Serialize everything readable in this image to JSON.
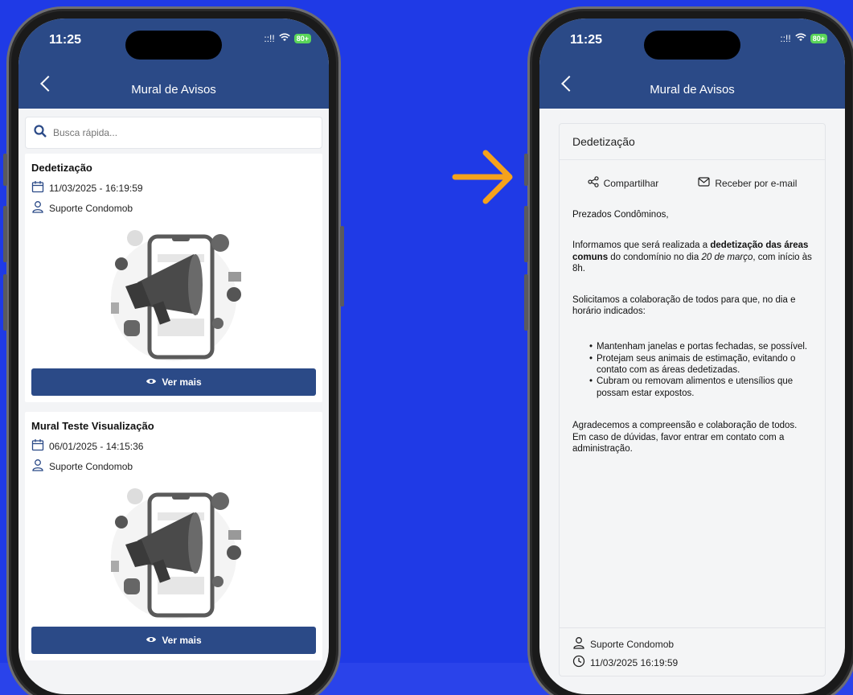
{
  "status": {
    "time": "11:25",
    "signal": "::!!",
    "battery": "80+"
  },
  "left_screen": {
    "header_title": "Mural de Avisos",
    "search_placeholder": "Busca rápida...",
    "cards": [
      {
        "title": "Dedetização",
        "date": "11/03/2025 - 16:19:59",
        "author": "Suporte Condomob",
        "button": "Ver mais"
      },
      {
        "title": "Mural Teste Visualização",
        "date": "06/01/2025 - 14:15:36",
        "author": "Suporte Condomob",
        "button": "Ver mais"
      }
    ]
  },
  "right_screen": {
    "header_title": "Mural de Avisos",
    "detail_title": "Dedetização",
    "share_label": "Compartilhar",
    "email_label": "Receber por e-mail",
    "greeting": "Prezados Condôminos,",
    "para1_pre": "Informamos que será realizada a ",
    "para1_bold": "dedetização das áreas comuns",
    "para1_mid": " do condomínio no dia ",
    "para1_italic": "20 de março",
    "para1_post": ", com início às 8h.",
    "para2": "Solicitamos a colaboração de todos para que, no dia e horário indicados:",
    "bullets": [
      "Mantenham janelas e portas fechadas, se possível.",
      "Protejam seus animais de estimação, evitando o contato com as áreas dedetizadas.",
      "Cubram ou removam alimentos e utensílios que possam estar expostos."
    ],
    "para3": "Agradecemos a compreensão e colaboração de todos. Em caso de dúvidas, favor entrar em contato com a administração.",
    "footer_author": "Suporte Condomob",
    "footer_date": "11/03/2025 16:19:59"
  },
  "colors": {
    "background": "#1f3ae6",
    "header": "#2b4a87",
    "arrow": "#f5a21c"
  }
}
